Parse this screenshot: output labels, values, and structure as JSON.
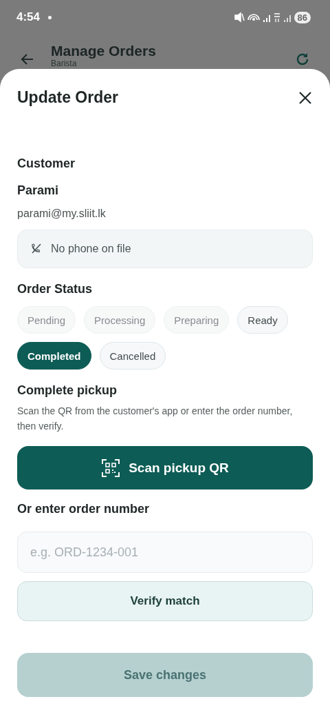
{
  "status_bar": {
    "time": "4:54",
    "battery": "86"
  },
  "app_bar": {
    "title": "Manage Orders",
    "subtitle": "Barista"
  },
  "sheet": {
    "title": "Update Order",
    "customer": {
      "heading": "Customer",
      "name": "Parami",
      "email": "parami@my.sliit.lk",
      "phone": "No phone on file"
    },
    "order_status": {
      "heading": "Order Status",
      "options": [
        {
          "label": "Pending",
          "selected": false,
          "disabled": true
        },
        {
          "label": "Processing",
          "selected": false,
          "disabled": true
        },
        {
          "label": "Preparing",
          "selected": false,
          "disabled": true
        },
        {
          "label": "Ready",
          "selected": false,
          "disabled": false
        },
        {
          "label": "Completed",
          "selected": true,
          "disabled": false
        },
        {
          "label": "Cancelled",
          "selected": false,
          "disabled": false
        }
      ]
    },
    "pickup": {
      "heading": "Complete pickup",
      "description": "Scan the QR from the customer's app or enter the order number, then verify.",
      "scan_button": "Scan pickup QR",
      "order_number_label": "Or enter order number",
      "order_number_placeholder": "e.g. ORD-1234-001",
      "verify_button": "Verify match"
    },
    "save_button": {
      "label": "Save changes",
      "disabled": true
    }
  }
}
